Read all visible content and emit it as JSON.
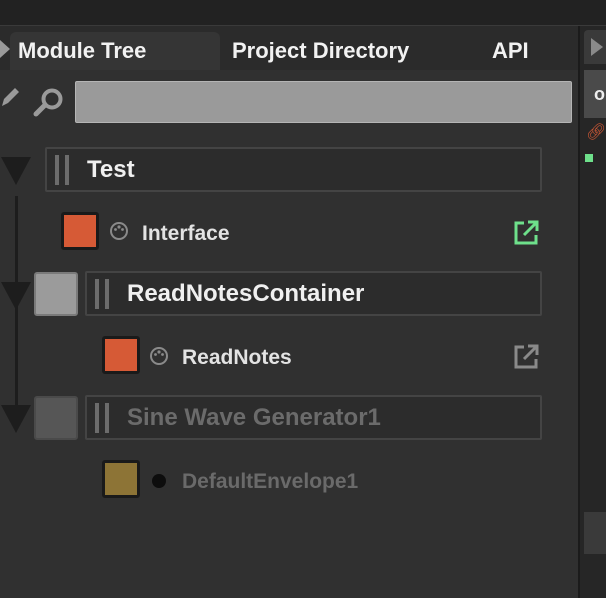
{
  "tabs": {
    "module_tree": "Module Tree",
    "project_directory": "Project Directory",
    "api": "API"
  },
  "filter": {
    "value": "",
    "placeholder": ""
  },
  "right_panel": {
    "tab_letter": "o"
  },
  "tree": {
    "root": {
      "label": "Test",
      "child": {
        "label": "Interface",
        "color": "#d65a36"
      }
    },
    "containers": [
      {
        "label": "ReadNotesContainer",
        "enabled": true,
        "child": {
          "label": "ReadNotes",
          "color": "#d65a36"
        }
      },
      {
        "label": "Sine Wave Generator1",
        "enabled": false,
        "child": {
          "label": "DefaultEnvelope1",
          "color": "#8d7436"
        }
      }
    ]
  },
  "colors": {
    "accent_orange": "#d65a36",
    "link_green": "#6ee08b",
    "panel_bg": "#303030"
  }
}
